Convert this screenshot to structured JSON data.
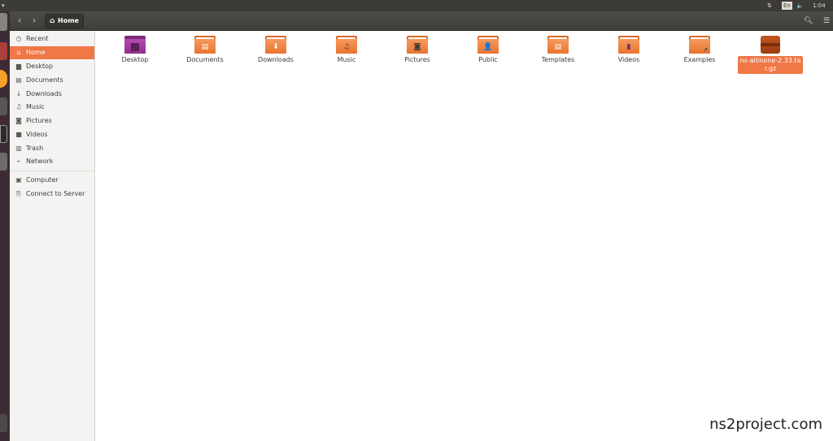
{
  "topbar": {
    "network_icon": "network-arrows-icon",
    "language": "En",
    "volume_icon": "volume-icon",
    "time": "1:04 AM"
  },
  "launcher": {
    "items": [
      "ubuntu-icon",
      "files-icon",
      "firefox-icon",
      "settings-icon",
      "terminal-icon",
      "software-icon"
    ],
    "colors": [
      "#86847f",
      "#a8423b",
      "#f7a025",
      "#565656",
      "#2b2b2b",
      "#6b6b6b"
    ]
  },
  "headerbar": {
    "back_icon": "back-icon",
    "forward_icon": "forward-icon",
    "breadcrumb": "Home",
    "search_icon": "search-icon",
    "view_icon": "list-view-icon"
  },
  "sidebar": {
    "items": [
      {
        "label": "Recent",
        "icon": "clock-icon",
        "glyph": "◷"
      },
      {
        "label": "Home",
        "icon": "home-icon",
        "glyph": "⌂",
        "active": true
      },
      {
        "label": "Desktop",
        "icon": "folder-icon",
        "glyph": "▆"
      },
      {
        "label": "Documents",
        "icon": "document-icon",
        "glyph": "▤"
      },
      {
        "label": "Downloads",
        "icon": "download-icon",
        "glyph": "↓"
      },
      {
        "label": "Music",
        "icon": "music-icon",
        "glyph": "♫"
      },
      {
        "label": "Pictures",
        "icon": "camera-icon",
        "glyph": "◙"
      },
      {
        "label": "Videos",
        "icon": "video-icon",
        "glyph": "■"
      },
      {
        "label": "Trash",
        "icon": "trash-icon",
        "glyph": "▥"
      },
      {
        "label": "Network",
        "icon": "network-icon",
        "glyph": "⌁"
      }
    ],
    "devices": [
      {
        "label": "Computer",
        "icon": "computer-icon",
        "glyph": "▣"
      },
      {
        "label": "Connect to Server",
        "icon": "server-icon",
        "glyph": "⎘"
      }
    ]
  },
  "files": [
    {
      "name": "Desktop",
      "type": "desktop-folder",
      "emblem": ""
    },
    {
      "name": "Documents",
      "type": "folder",
      "emblem": "▤"
    },
    {
      "name": "Downloads",
      "type": "folder",
      "emblem": "⬇"
    },
    {
      "name": "Music",
      "type": "folder",
      "emblem": "♫"
    },
    {
      "name": "Pictures",
      "type": "folder",
      "emblem": "◙"
    },
    {
      "name": "Public",
      "type": "folder",
      "emblem": "👤"
    },
    {
      "name": "Templates",
      "type": "folder",
      "emblem": "▤"
    },
    {
      "name": "Videos",
      "type": "folder",
      "emblem": "▮"
    },
    {
      "name": "Examples",
      "type": "folder",
      "emblem": "↗"
    },
    {
      "name": "ns-allinone-2.33.tar.gz",
      "type": "archive",
      "selected": true
    }
  ],
  "watermark": "ns2project.com"
}
